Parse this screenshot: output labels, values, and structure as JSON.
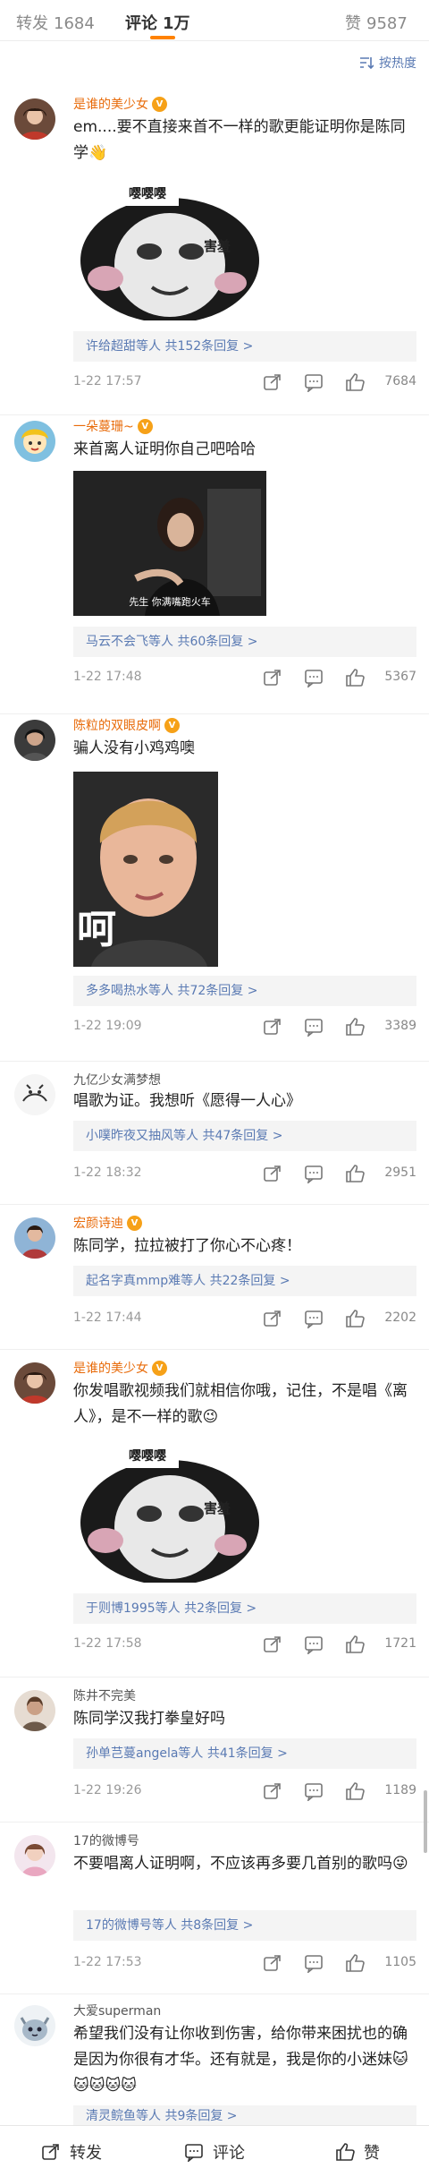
{
  "tabs": [
    {
      "label": "转发",
      "count": "1684"
    },
    {
      "label": "评论",
      "count": "1万"
    },
    {
      "label": "赞",
      "count": "9587"
    }
  ],
  "sort_label": "按热度",
  "comments": [
    {
      "user": "是谁的美少女",
      "text": "em....要不直接来首不一样的歌更能证明你是陈同学👋",
      "sticker_text": [
        "嘤嘤嘤",
        "害羞"
      ],
      "replies": "许给超甜等人 共152条回复 >",
      "time": "1-22 17:57",
      "likes": "7684"
    },
    {
      "user": "一朵蔓珊~",
      "text": "来首离人证明你自己吧哈哈",
      "gif_caption": "先生 你满嘴跑火车",
      "replies": "马云不会飞等人 共60条回复 >",
      "time": "1-22 17:48",
      "likes": "5367"
    },
    {
      "user": "陈粒的双眼皮啊",
      "text": "骗人没有小鸡鸡噢",
      "sticker_text": [
        "呵"
      ],
      "replies": "多多喝热水等人 共72条回复 >",
      "time": "1-22 19:09",
      "likes": "3389"
    },
    {
      "user": "九亿少女满梦想",
      "text": "唱歌为证。我想听《愿得一人心》",
      "replies": "小噗昨夜又抽风等人 共47条回复 >",
      "time": "1-22 18:32",
      "likes": "2951"
    },
    {
      "user": "宏颜诗迪",
      "text": "陈同学，拉拉被打了你心不心疼！",
      "replies": "起名字真mmp难等人 共22条回复 >",
      "time": "1-22 17:44",
      "likes": "2202"
    },
    {
      "user": "是谁的美少女",
      "text": "你发唱歌视频我们就相信你哦，记住，不是唱《离人》，是不一样的歌😉",
      "sticker_text": [
        "嘤嘤嘤",
        "害羞"
      ],
      "replies": "于则博1995等人 共2条回复 >",
      "time": "1-22 17:58",
      "likes": "1721"
    },
    {
      "user": "陈井不完美",
      "text": "陈同学汉我打拳皇好吗",
      "replies": "孙单芑蔓angela等人 共41条回复 >",
      "time": "1-22 19:26",
      "likes": "1189"
    },
    {
      "user": "17的微博号",
      "text": "不要唱离人证明啊，不应该再多要几首别的歌吗😜",
      "replies": "17的微博号等人 共8条回复 >",
      "time": "1-22 17:53",
      "likes": "1105"
    },
    {
      "user": "大爱superman",
      "text": "希望我们没有让你收到伤害，给你带来困扰也的确是因为你很有才华。还有就是，我是你的小迷妹🐱🐱🐱🐱🐱",
      "replies": "清灵鲩鱼等人 共9条回复 >"
    }
  ],
  "bottom": {
    "repost": "转发",
    "comment": "评论",
    "like": "赞"
  },
  "colors": {
    "accent": "#ff8200",
    "link": "#5a7ab3",
    "vip_name": "#e86b0a"
  }
}
